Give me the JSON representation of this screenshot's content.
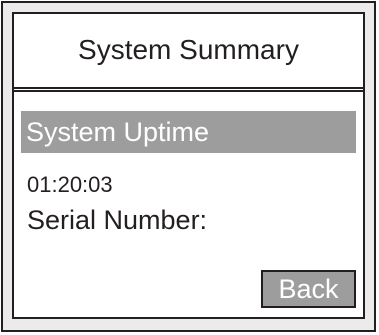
{
  "screen": {
    "title": "System Summary",
    "selected_item": "System Uptime",
    "uptime_value": "01:20:03",
    "serial_label": "Serial Number:",
    "back_label": "Back"
  },
  "colors": {
    "frame": "#231f20",
    "bezel": "#ebebeb",
    "screen_bg": "#ffffff",
    "highlight": "#9d9d9d",
    "highlight_text": "#ffffff"
  }
}
